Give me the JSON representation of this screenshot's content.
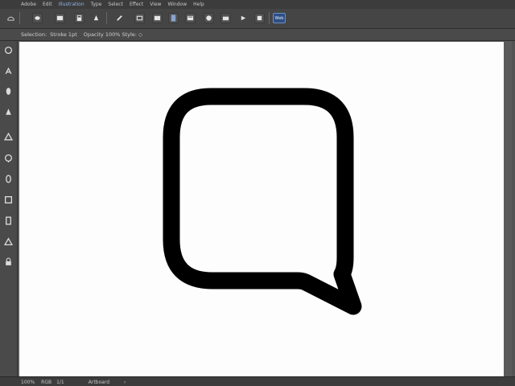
{
  "menubar": {
    "items": [
      {
        "label": "Adobe"
      },
      {
        "label": "Edit"
      },
      {
        "label": "Illustration"
      },
      {
        "label": "Type"
      },
      {
        "label": "Select"
      },
      {
        "label": "Effect"
      },
      {
        "label": "View"
      },
      {
        "label": "Window"
      },
      {
        "label": "Help"
      }
    ],
    "active_index": 2
  },
  "options_bar": {
    "label_1": "Selection:",
    "label_2": "Stroke 1pt",
    "label_3": "Opacity 100% Style: ◇"
  },
  "toolbar": {
    "icons": [
      "new-file-icon",
      "open-folder-icon",
      "save-icon",
      "print-icon",
      "pen-icon",
      "rectangle-icon",
      "shape-icon",
      "document-icon",
      "layers-icon",
      "color-icon",
      "camera-icon",
      "arrow-icon",
      "eraser-icon",
      "web-icon"
    ],
    "web_label": "Web"
  },
  "tools": {
    "icons": [
      "lasso-tool-icon",
      "pen-tool-icon",
      "brush-tool-icon",
      "paint-tool-icon",
      "fill-tool-icon",
      "zoom-tool-icon",
      "rotate-tool-icon",
      "frame-tool-icon",
      "eyedropper-tool-icon",
      "triangle-tool-icon",
      "lock-tool-icon"
    ]
  },
  "canvas": {
    "shape": "speech-bubble-icon",
    "stroke_color": "#000000",
    "background_color": "#fdfdfd"
  },
  "statusbar": {
    "item_1": "100%",
    "item_2": "RGB",
    "item_3": "1/1",
    "item_4": "Artboard",
    "item_5": "›"
  }
}
